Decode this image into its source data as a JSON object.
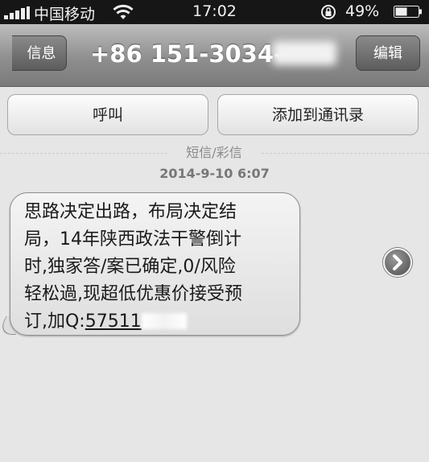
{
  "status_bar": {
    "carrier": "中国移动",
    "time": "17:02",
    "battery_percent": "49%",
    "icons": [
      "signal-icon",
      "wifi-icon",
      "rotation-lock-icon",
      "battery-icon"
    ]
  },
  "nav": {
    "back_label": "信息",
    "title": "+86 151-3034-",
    "edit_label": "编辑"
  },
  "actions": {
    "call_label": "呼叫",
    "add_contact_label": "添加到通讯录"
  },
  "thread": {
    "divider_label": "短信/彩信",
    "timestamp": "2014-9-10 6:07"
  },
  "message": {
    "lines": [
      "思路决定出路，布局决定结",
      "局，14年陕西政法干警倒计",
      "时,独家答/案已确定,0/风险",
      "轻松過,现超低优惠价接受预",
      "订,加Q:"
    ],
    "qq_visible": "57511"
  }
}
